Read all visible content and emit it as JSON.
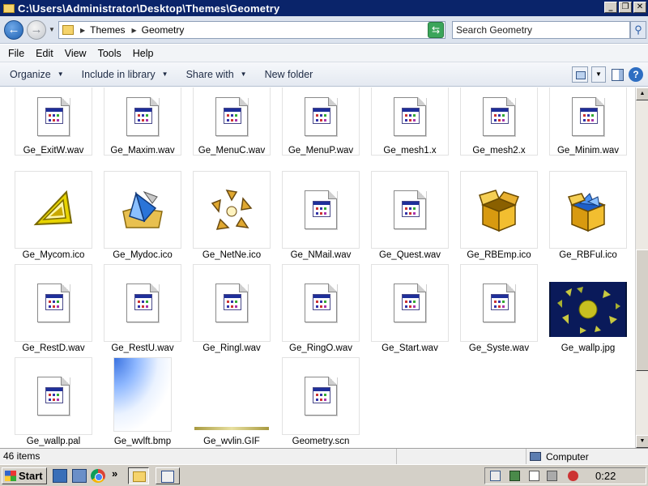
{
  "window": {
    "title": "C:\\Users\\Administrator\\Desktop\\Themes\\Geometry",
    "controls": [
      "_",
      "❐",
      "✕"
    ]
  },
  "address": {
    "crumbs": [
      "Themes",
      "Geometry"
    ],
    "search_placeholder": "Search Geometry"
  },
  "menu": [
    "File",
    "Edit",
    "View",
    "Tools",
    "Help"
  ],
  "commands": {
    "organize": "Organize",
    "include": "Include in library",
    "share": "Share with",
    "new_folder": "New folder",
    "help": "?"
  },
  "files": [
    {
      "name": "Ge_ExitW.wav",
      "icon": "sound-file-icon"
    },
    {
      "name": "Ge_Maxim.wav",
      "icon": "sound-file-icon"
    },
    {
      "name": "Ge_MenuC.wav",
      "icon": "sound-file-icon"
    },
    {
      "name": "Ge_MenuP.wav",
      "icon": "sound-file-icon"
    },
    {
      "name": "Ge_mesh1.x",
      "icon": "generic-file-icon"
    },
    {
      "name": "Ge_mesh2.x",
      "icon": "generic-file-icon"
    },
    {
      "name": "Ge_Minim.wav",
      "icon": "sound-file-icon"
    },
    {
      "name": "Ge_Mycom.ico",
      "icon": "geometry-computer-icon"
    },
    {
      "name": "Ge_Mydoc.ico",
      "icon": "geometry-documents-icon"
    },
    {
      "name": "Ge_NetNe.ico",
      "icon": "geometry-network-icon"
    },
    {
      "name": "Ge_NMail.wav",
      "icon": "sound-file-icon"
    },
    {
      "name": "Ge_Quest.wav",
      "icon": "sound-file-icon"
    },
    {
      "name": "Ge_RBEmp.ico",
      "icon": "recycle-bin-empty-icon"
    },
    {
      "name": "Ge_RBFul.ico",
      "icon": "recycle-bin-full-icon"
    },
    {
      "name": "Ge_RestD.wav",
      "icon": "sound-file-icon"
    },
    {
      "name": "Ge_RestU.wav",
      "icon": "sound-file-icon"
    },
    {
      "name": "Ge_Ringl.wav",
      "icon": "sound-file-icon"
    },
    {
      "name": "Ge_RingO.wav",
      "icon": "sound-file-icon"
    },
    {
      "name": "Ge_Start.wav",
      "icon": "sound-file-icon"
    },
    {
      "name": "Ge_Syste.wav",
      "icon": "sound-file-icon"
    },
    {
      "name": "Ge_wallp.jpg",
      "icon": "wallpaper-thumbnail"
    },
    {
      "name": "Ge_wallp.pal",
      "icon": "generic-file-icon"
    },
    {
      "name": "Ge_wvlft.bmp",
      "icon": "bitmap-thumbnail"
    },
    {
      "name": "Ge_wvlin.GIF",
      "icon": "gif-thumbnail"
    },
    {
      "name": "Geometry.scn",
      "icon": "generic-file-icon"
    }
  ],
  "status": {
    "count": "46 items",
    "zone": "Computer"
  },
  "taskbar": {
    "start": "Start",
    "more": "»",
    "clock": "0:22"
  }
}
